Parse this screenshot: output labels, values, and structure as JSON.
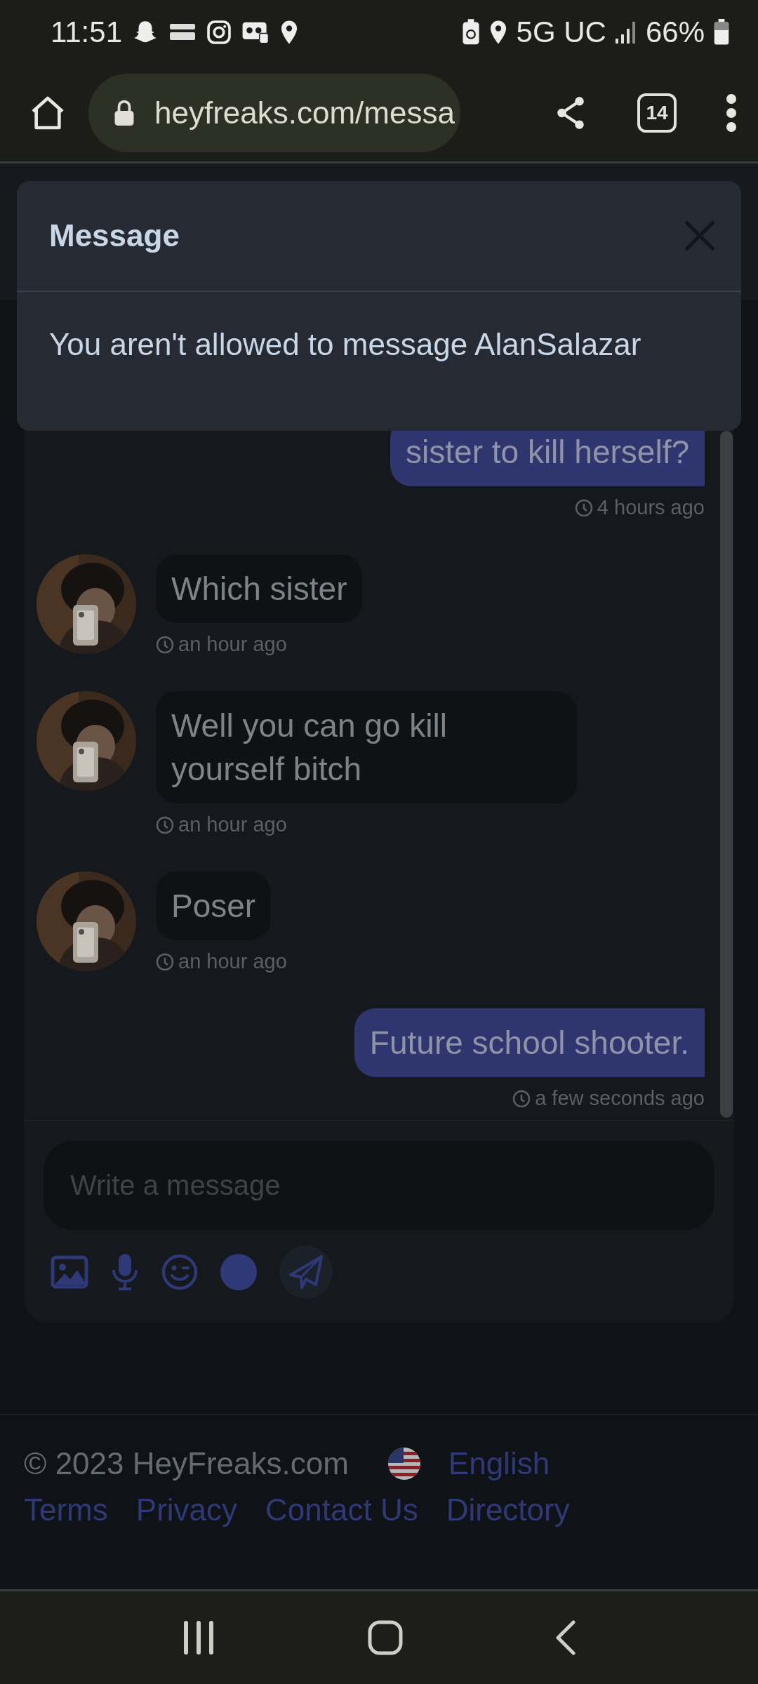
{
  "status_bar": {
    "time": "11:51",
    "network": "5G UC",
    "battery": "66%"
  },
  "browser": {
    "url": "heyfreaks.com/messa",
    "tab_count": "14"
  },
  "messages": [
    {
      "kind": "sent",
      "text": "sister to kill herself?",
      "time": "4 hours ago"
    },
    {
      "kind": "received",
      "text": "Which sister",
      "time": "an hour ago"
    },
    {
      "kind": "received",
      "text": "Well you can go kill yourself bitch",
      "time": "an hour ago"
    },
    {
      "kind": "received",
      "text": "Poser",
      "time": "an hour ago"
    },
    {
      "kind": "sent",
      "text": "Future school shooter.",
      "time": "a few seconds ago"
    }
  ],
  "composer": {
    "placeholder": "Write a message"
  },
  "modal": {
    "title": "Message",
    "body": "You aren't allowed to message AlanSalazar"
  },
  "footer": {
    "copyright": "© 2023 HeyFreaks.com",
    "language": "English",
    "links": [
      "Terms",
      "Privacy",
      "Contact Us",
      "Directory"
    ]
  }
}
